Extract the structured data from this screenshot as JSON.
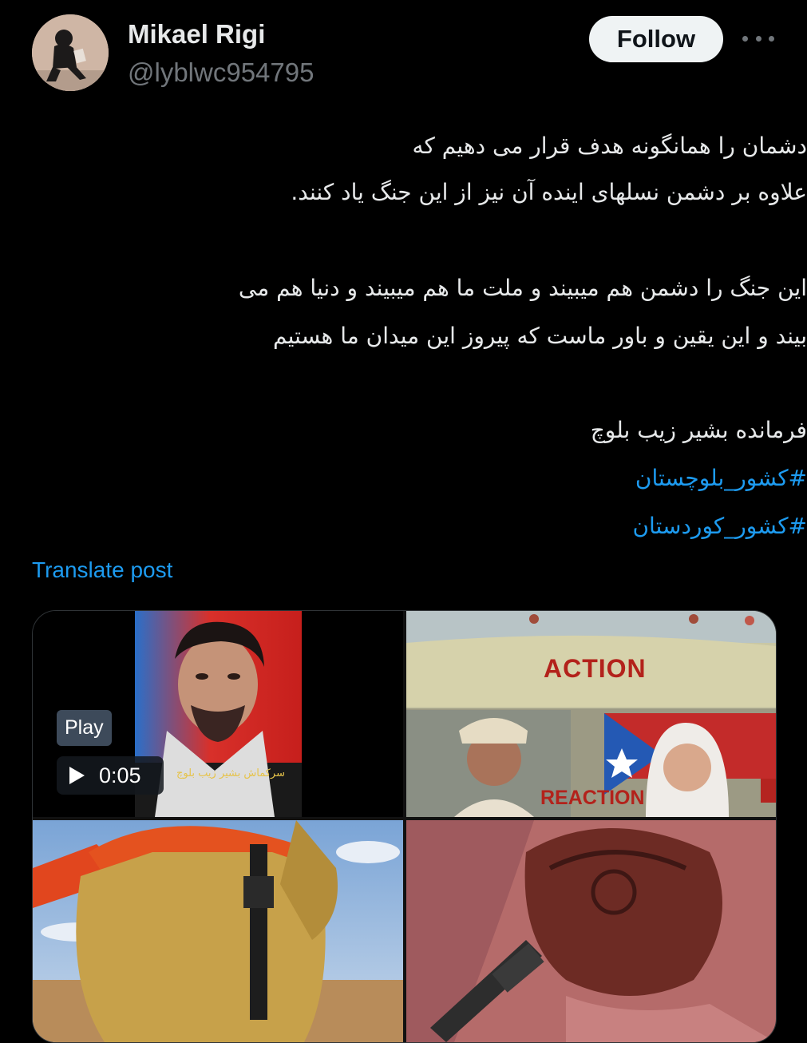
{
  "author": {
    "name": "Mikael Rigi",
    "handle": "@lyblwc954795"
  },
  "actions": {
    "follow_label": "Follow",
    "more_icon": "more-horizontal-icon"
  },
  "tweet": {
    "lines": [
      "دشمان را همانگونه هدف قرار می دهیم که",
      "علاوه بر دشمن نسلهای اینده آن نیز از این جنگ یاد کنند.",
      "این جنگ را دشمن هم میبیند و ملت ما هم میبیند و دنیا هم می",
      "بیند و این یقین و باور ماست که پیروز این میدان ما هستیم",
      "فرمانده بشیر زیب بلوچ"
    ],
    "hashtags": [
      "#کشور_بلوچستان",
      "#کشور_کوردستان"
    ]
  },
  "translate_label": "Translate post",
  "media": {
    "video": {
      "play_label": "Play",
      "duration": "0:05",
      "caption": "سرکماش بشیر زیب بلوچ"
    },
    "image2": {
      "top_text": "ACTION",
      "bottom_text": "REACTION"
    }
  },
  "colors": {
    "accent": "#1d9bf0",
    "background": "#000000",
    "text": "#e7e9ea",
    "muted": "#71767b"
  }
}
